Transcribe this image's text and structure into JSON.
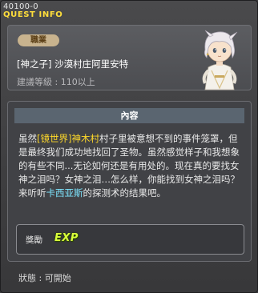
{
  "window": {
    "quest_id": "40100-0",
    "title": "QUEST INFO"
  },
  "header": {
    "job_badge": "職業",
    "npc_name": "[神之子] 沙漠村庄阿里安特",
    "level_label": "建議等級 : ",
    "level_value": "110以上",
    "portrait_icon": "npc-portrait-white-haired-boy"
  },
  "content": {
    "header": "內容",
    "segments": [
      {
        "text": "虽然",
        "style": "plain"
      },
      {
        "text": "[镜世界]神木村",
        "style": "yellow"
      },
      {
        "text": "村子里被意想不到的事件笼罩，但是最终我们成功地找回了圣物。虽然感觉样子和我想象的有些不同...无论如何还是有用处的。现在真的要找女神之泪吗？女神之泪…怎么样，你能找到女神之泪吗？来听听",
        "style": "plain"
      },
      {
        "text": "卡西亚斯",
        "style": "cyan"
      },
      {
        "text": "的探测术的结果吧。",
        "style": "plain"
      }
    ]
  },
  "reward": {
    "label": "獎勵",
    "exp_text": "EXP",
    "exp_icon": "exp-icon"
  },
  "status": {
    "label": "狀態 : ",
    "value": "可開始"
  },
  "colors": {
    "highlight_yellow": "#ffd92a",
    "highlight_cyan": "#7ee6ff",
    "title_yellow": "#ffde3b"
  }
}
